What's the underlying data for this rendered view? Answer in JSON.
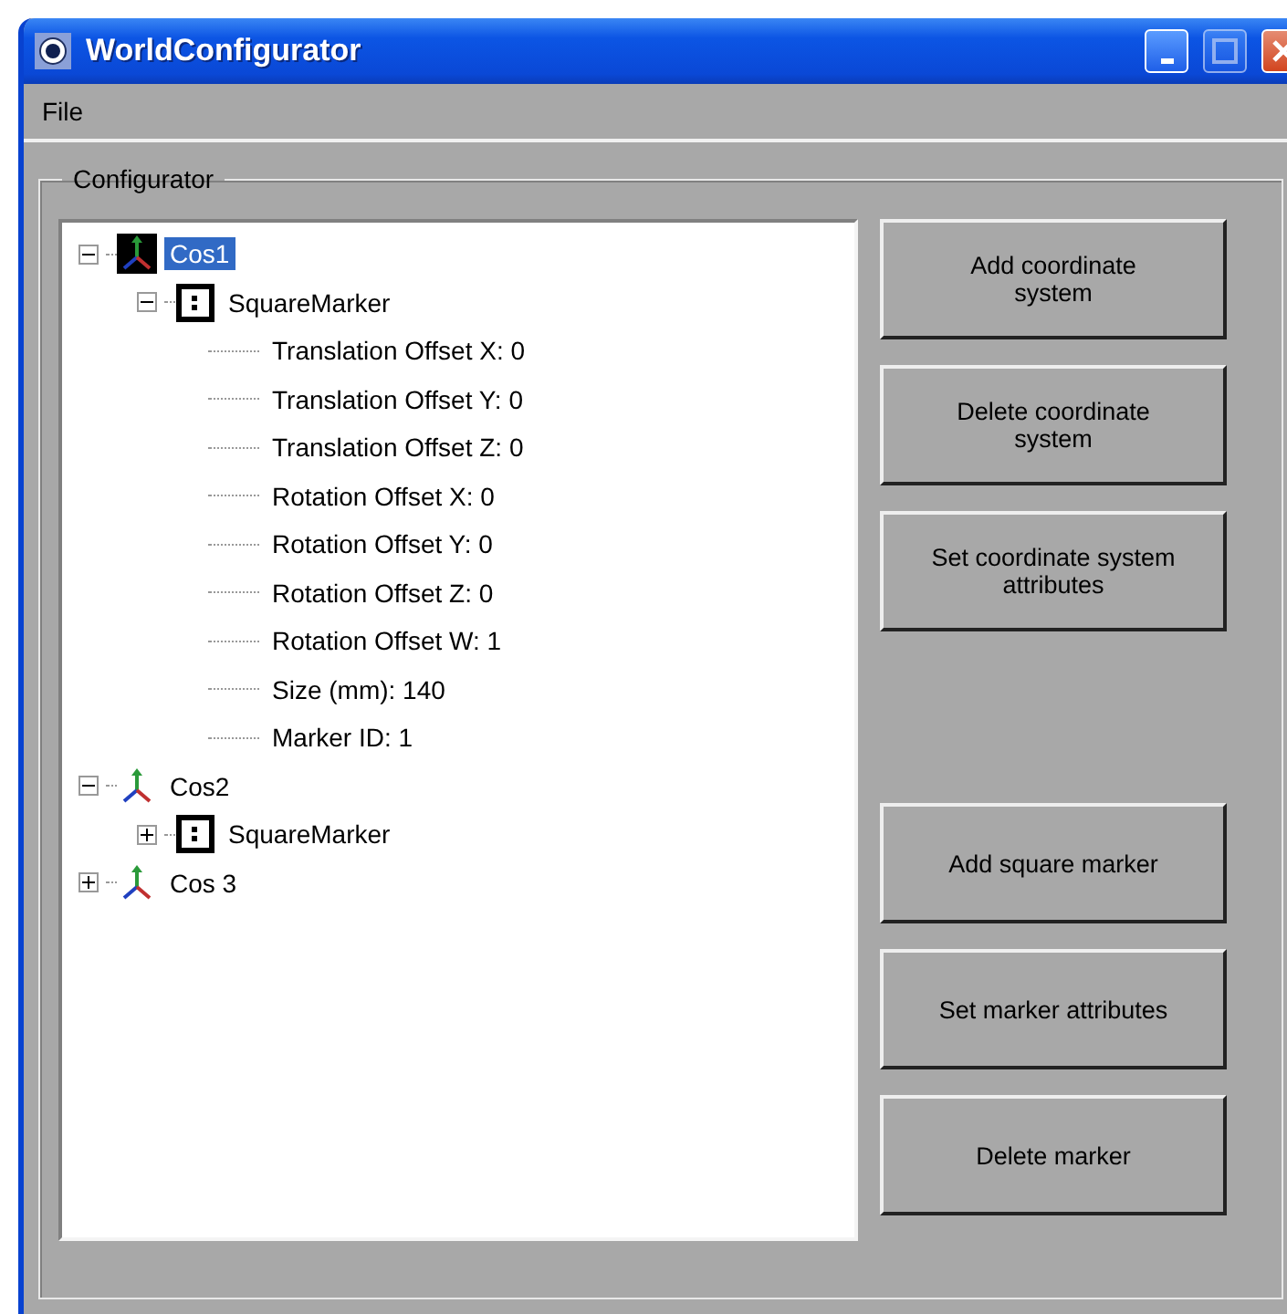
{
  "window": {
    "title": "WorldConfigurator"
  },
  "menu": [
    {
      "label": "File"
    }
  ],
  "group": {
    "label": "Configurator"
  },
  "tree": [
    {
      "kind": "coordinate",
      "label": "Cos1",
      "selected": true,
      "expanded": true,
      "children": [
        {
          "kind": "marker",
          "label": "SquareMarker",
          "selected": false,
          "expanded": true,
          "children": [
            {
              "kind": "property",
              "label": "Translation Offset X: 0",
              "selected": false
            },
            {
              "kind": "property",
              "label": "Translation Offset Y: 0",
              "selected": false
            },
            {
              "kind": "property",
              "label": "Translation Offset Z: 0",
              "selected": false
            },
            {
              "kind": "property",
              "label": "Rotation Offset X: 0",
              "selected": false
            },
            {
              "kind": "property",
              "label": "Rotation Offset Y: 0",
              "selected": false
            },
            {
              "kind": "property",
              "label": "Rotation Offset Z: 0",
              "selected": false
            },
            {
              "kind": "property",
              "label": "Rotation Offset W: 1",
              "selected": false
            },
            {
              "kind": "property",
              "label": "Size (mm): 140",
              "selected": false
            },
            {
              "kind": "property",
              "label": "Marker ID: 1",
              "selected": false
            }
          ]
        }
      ]
    },
    {
      "kind": "coordinate",
      "label": "Cos2",
      "selected": false,
      "expanded": true,
      "children": [
        {
          "kind": "marker",
          "label": "SquareMarker",
          "selected": false,
          "expanded": false
        }
      ]
    },
    {
      "kind": "coordinate",
      "label": "Cos 3",
      "selected": false,
      "expanded": false
    }
  ],
  "button_groups": [
    [
      "Add coordinate system",
      "Delete coordinate system",
      "Set coordinate system attributes"
    ],
    [
      "Add square marker",
      "Set marker attributes",
      "Delete marker"
    ]
  ]
}
